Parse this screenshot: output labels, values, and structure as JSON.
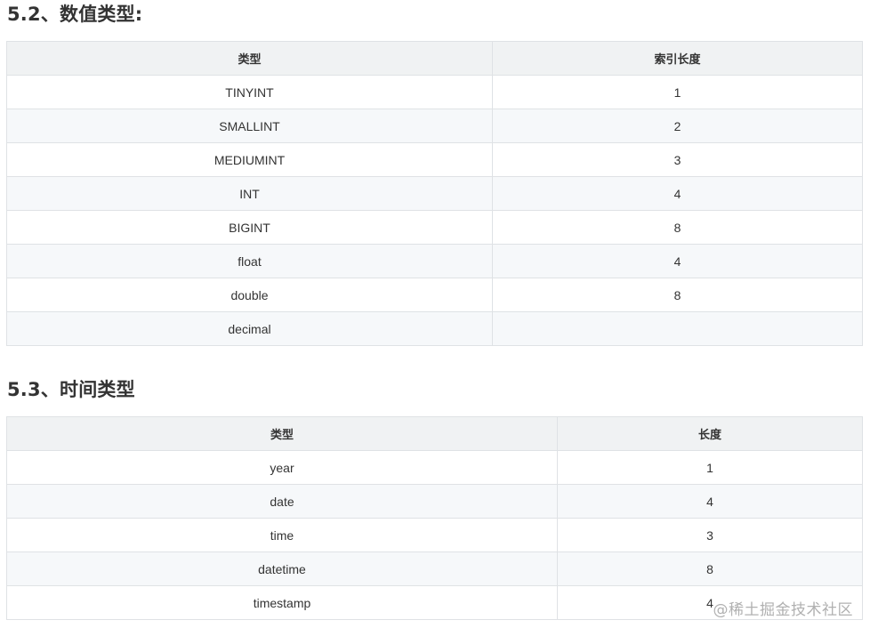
{
  "section_numeric": {
    "heading": "5.2、数值类型:",
    "columns": [
      "类型",
      "索引长度"
    ],
    "rows": [
      [
        "TINYINT",
        "1"
      ],
      [
        "SMALLINT",
        "2"
      ],
      [
        "MEDIUMINT",
        "3"
      ],
      [
        "INT",
        "4"
      ],
      [
        "BIGINT",
        "8"
      ],
      [
        "float",
        "4"
      ],
      [
        "double",
        "8"
      ],
      [
        "decimal",
        ""
      ]
    ]
  },
  "section_time": {
    "heading": "5.3、时间类型",
    "columns": [
      "类型",
      "长度"
    ],
    "rows": [
      [
        "year",
        "1"
      ],
      [
        "date",
        "4"
      ],
      [
        "time",
        "3"
      ],
      [
        "datetime",
        "8"
      ],
      [
        "timestamp",
        "4"
      ]
    ]
  },
  "watermark": "@稀土掘金技术社区"
}
